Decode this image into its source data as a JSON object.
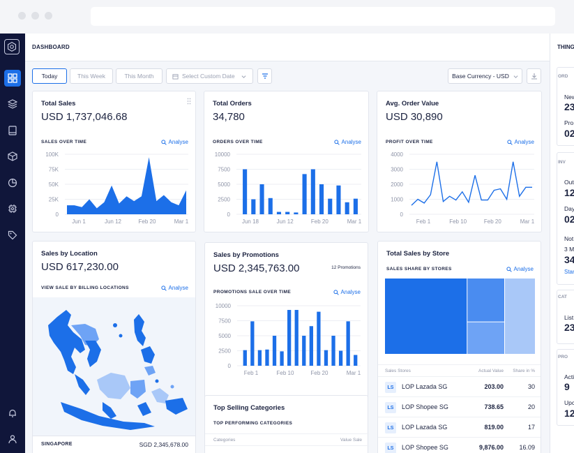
{
  "header": {
    "title": "DASHBOARD",
    "right_panel_title": "THING"
  },
  "filters": {
    "today": "Today",
    "this_week": "This Week",
    "this_month": "This Month",
    "custom_date": "Select Custom Date",
    "currency": "Base Currency - USD"
  },
  "analyse_label": "Analyse",
  "cards": {
    "total_sales": {
      "title": "Total Sales",
      "value": "USD 1,737,046.68",
      "sub": "SALES OVER TIME"
    },
    "total_orders": {
      "title": "Total Orders",
      "value": "34,780",
      "sub": "ORDERS OVER TIME"
    },
    "avg_order": {
      "title": "Avg. Order Value",
      "value": "USD 30,890",
      "sub": "PROFIT OVER TIME"
    },
    "location": {
      "title": "Sales by Location",
      "value": "USD 617,230.00",
      "sub": "VIEW SALE BY BILLING LOCATIONS",
      "footer_country": "SINGAPORE",
      "footer_value": "SGD 2,345,678.00"
    },
    "promotions": {
      "title": "Sales by Promotions",
      "value": "USD 2,345,763.00",
      "badge": "12 Promotions",
      "sub": "PROMOTIONS SALE OVER TIME"
    },
    "store": {
      "title": "Total Sales by Store",
      "sub": "SALES SHARE BY STORES",
      "col_store": "Sales Stores",
      "col_value": "Actual Value",
      "col_share": "Share in %"
    },
    "categories": {
      "title": "Top Selling Categories",
      "sub": "TOP PERFORMING CATEGORIES",
      "col_cat": "Categories",
      "col_value": "Value Sale"
    }
  },
  "stores": [
    {
      "initials": "LS",
      "name": "LOP Lazada SG",
      "value": "203.00",
      "share": "30"
    },
    {
      "initials": "LS",
      "name": "LOP Shopee SG",
      "value": "738.65",
      "share": "20"
    },
    {
      "initials": "LS",
      "name": "LOP Lazada SG",
      "value": "819.00",
      "share": "17"
    },
    {
      "initials": "LS",
      "name": "LOP Shopee SG",
      "value": "9,876.00",
      "share": "16.09"
    }
  ],
  "right_panel": {
    "sections": [
      {
        "title": "ORD",
        "items": [
          {
            "label": "New",
            "value": "23"
          },
          {
            "label": "Pro",
            "value": "02"
          }
        ]
      },
      {
        "title": "INV",
        "items": [
          {
            "label": "Out",
            "value": "12"
          },
          {
            "label": "Day",
            "value": "02"
          },
          {
            "label": "Not",
            "value": ""
          },
          {
            "label": "3 M",
            "value": "34"
          }
        ],
        "link": "Star"
      },
      {
        "title": "CAT",
        "items": [
          {
            "label": "List",
            "value": "23"
          }
        ]
      },
      {
        "title": "PRO",
        "items": [
          {
            "label": "Acti",
            "value": "9"
          },
          {
            "label": "Upc",
            "value": "12"
          }
        ]
      }
    ]
  },
  "colors": {
    "accent": "#1c6fe8",
    "sidebar": "#10163a"
  },
  "chart_data": [
    {
      "type": "area",
      "title": "SALES OVER TIME",
      "x_ticks": [
        "Jun 1",
        "Jun 12",
        "Feb 20",
        "Mar 1"
      ],
      "y_ticks": [
        "100K",
        "75K",
        "50K",
        "25K",
        "0"
      ],
      "ylim": [
        0,
        100000
      ],
      "values": [
        15000,
        15000,
        12000,
        25000,
        10000,
        20000,
        48000,
        18000,
        30000,
        22000,
        30000,
        95000,
        22000,
        32000,
        20000,
        15000,
        40000
      ]
    },
    {
      "type": "bar",
      "title": "ORDERS OVER TIME",
      "x_ticks": [
        "Jun 18",
        "Jun 12",
        "Feb 20",
        "Mar 1"
      ],
      "y_ticks": [
        "10000",
        "7500",
        "5000",
        "2500",
        "0"
      ],
      "ylim": [
        0,
        10000
      ],
      "values": [
        7500,
        2500,
        5000,
        2700,
        400,
        400,
        300,
        6700,
        7500,
        5000,
        2600,
        4800,
        2000,
        2600
      ]
    },
    {
      "type": "line",
      "title": "PROFIT OVER TIME",
      "x_ticks": [
        "Feb 1",
        "Feb 10",
        "Feb 20",
        "Mar 1"
      ],
      "y_ticks": [
        "4000",
        "3000",
        "2000",
        "1000",
        "0"
      ],
      "ylim": [
        0,
        4000
      ],
      "values": [
        600,
        1000,
        750,
        1300,
        3500,
        850,
        1200,
        950,
        1500,
        800,
        2600,
        950,
        950,
        1600,
        1700,
        1000,
        3500,
        1200,
        1800,
        1800
      ]
    },
    {
      "type": "bar",
      "title": "PROMOTIONS SALE OVER TIME",
      "x_ticks": [
        "Feb 1",
        "Feb 10",
        "Feb 20",
        "Mar 1"
      ],
      "y_ticks": [
        "10000",
        "7500",
        "5000",
        "2500",
        "0"
      ],
      "ylim": [
        0,
        10000
      ],
      "values": [
        2600,
        7400,
        2600,
        2700,
        5000,
        2400,
        9300,
        9300,
        5000,
        6600,
        9000,
        2600,
        5000,
        2500,
        7400,
        1800
      ]
    },
    {
      "type": "heatmap",
      "title": "SALES SHARE BY STORES",
      "values": [
        0.55,
        0.25,
        0.2
      ]
    }
  ]
}
